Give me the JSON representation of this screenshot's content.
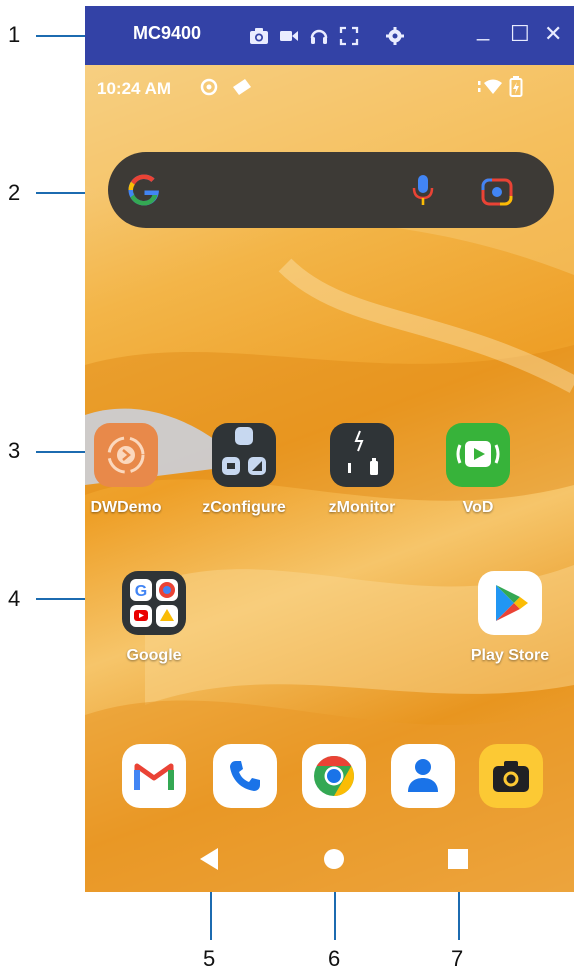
{
  "callouts": {
    "n1": "1",
    "n2": "2",
    "n3": "3",
    "n4": "4",
    "n5": "5",
    "n6": "6",
    "n7": "7"
  },
  "titlebar": {
    "title": "MC9400",
    "icons": [
      "camera-icon",
      "video-icon",
      "headset-icon",
      "fullscreen-icon",
      "settings-icon"
    ],
    "window_buttons": {
      "minimize": "_",
      "maximize": "☐",
      "close": "✕"
    },
    "color": "#3342a6"
  },
  "statusbar": {
    "time": "10:24 AM",
    "icons": [
      "settings-icon",
      "notification-icon",
      "wifi-icon",
      "battery-icon"
    ]
  },
  "search": {
    "icons": [
      "google-icon",
      "mic-icon",
      "lens-icon"
    ]
  },
  "apps": {
    "row1": [
      {
        "label": "DWDemo",
        "icon": "dwdemo-icon",
        "color": "#e8894a"
      },
      {
        "label": "zConfigure",
        "icon": "zconfigure-icon",
        "color": "#2f3437"
      },
      {
        "label": "zMonitor",
        "icon": "zmonitor-icon",
        "color": "#2f3437"
      },
      {
        "label": "VoD",
        "icon": "vod-icon",
        "color": "#37b33a"
      }
    ],
    "row2": [
      {
        "label": "Google",
        "icon": "google-folder-icon",
        "color": "#2f3437"
      },
      {
        "label": "Play Store",
        "icon": "play-store-icon",
        "color": "#ffffff"
      }
    ]
  },
  "dock": [
    "gmail-icon",
    "phone-icon",
    "chrome-icon",
    "contacts-icon",
    "camera-app-icon"
  ],
  "nav": [
    "back-icon",
    "home-icon",
    "recents-icon"
  ]
}
